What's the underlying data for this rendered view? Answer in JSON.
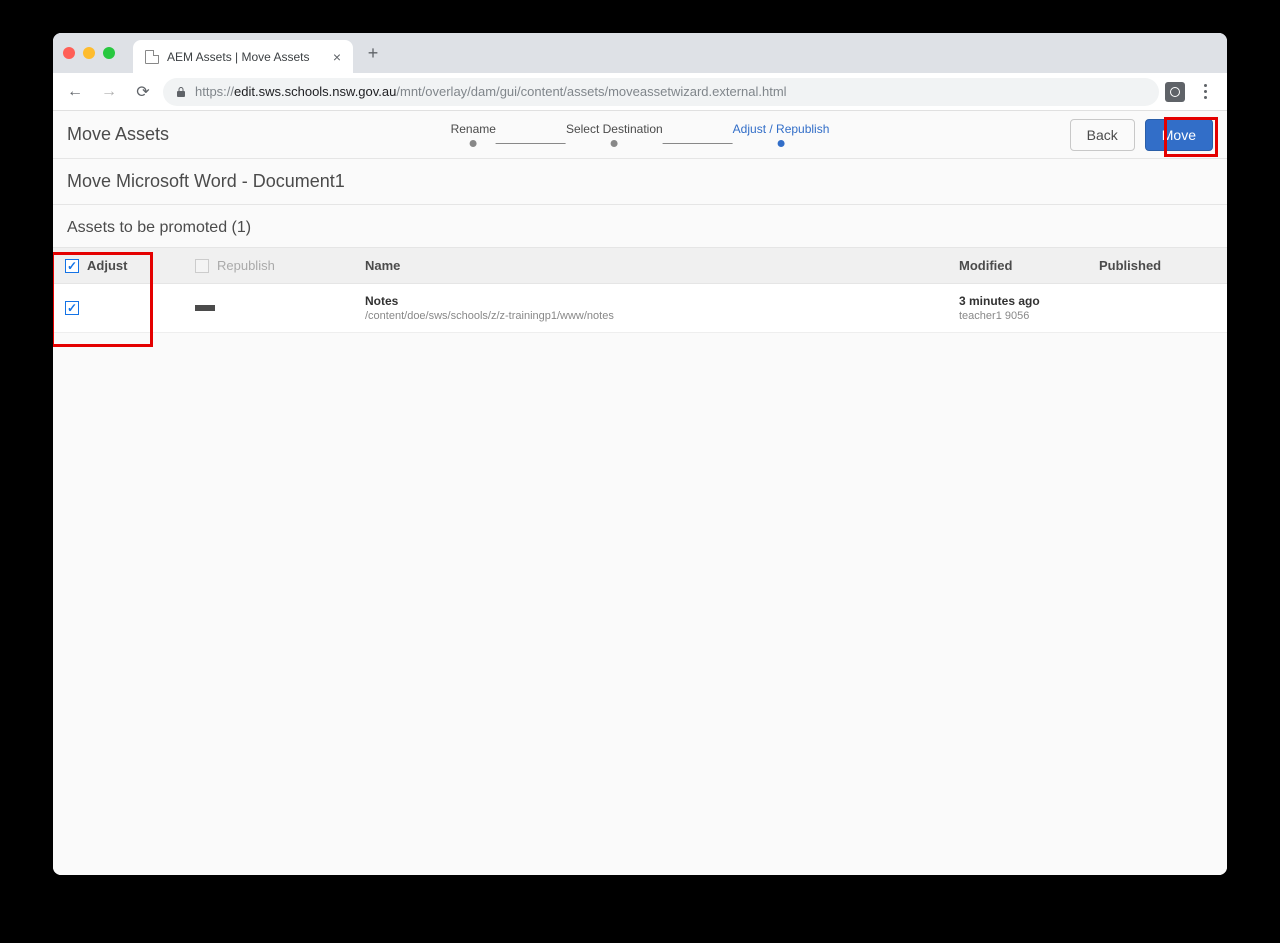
{
  "browser": {
    "tab_title": "AEM Assets | Move Assets",
    "url_prefix": "https://",
    "url_host": "edit.sws.schools.nsw.gov.au",
    "url_path": "/mnt/overlay/dam/gui/content/assets/moveassetwizard.external.html"
  },
  "app": {
    "title": "Move Assets",
    "steps": [
      "Rename",
      "Select Destination",
      "Adjust / Republish"
    ],
    "active_step_index": 2,
    "back_label": "Back",
    "move_label": "Move",
    "subheader": "Move Microsoft Word - Document1",
    "section_label": "Assets to be promoted (1)",
    "columns": {
      "adjust": "Adjust",
      "republish": "Republish",
      "name": "Name",
      "modified": "Modified",
      "published": "Published"
    },
    "row": {
      "adjust_checked": true,
      "republish_checked": false,
      "name": "Notes",
      "path": "/content/doe/sws/schools/z/z-trainingp1/www/notes",
      "modified_time": "3 minutes ago",
      "modified_user": "teacher1 9056",
      "published": ""
    }
  }
}
